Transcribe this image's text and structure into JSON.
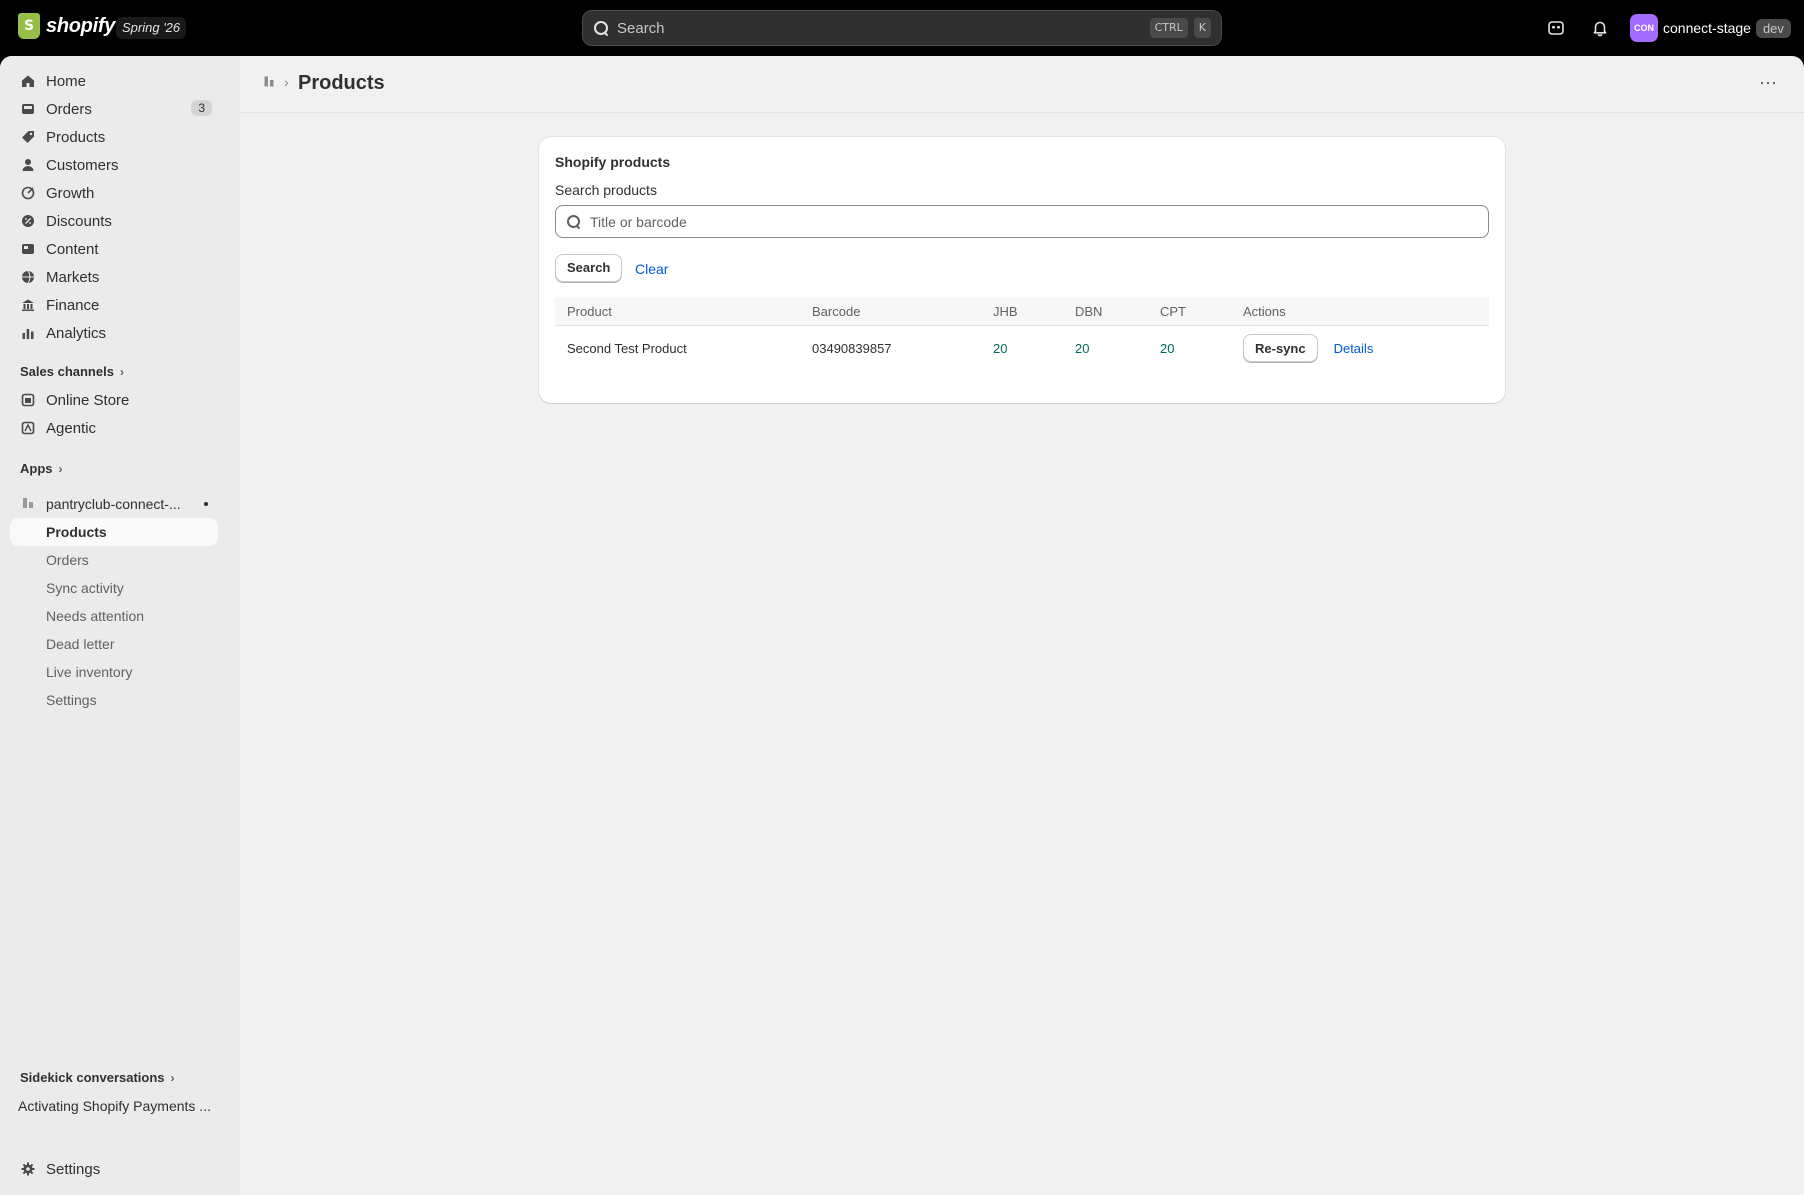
{
  "topbar": {
    "brand": "shopify",
    "version": "Spring '26",
    "search_placeholder": "Search",
    "shortcut_keys": [
      "CTRL",
      "K"
    ],
    "store_avatar": "CON",
    "store_name": "connect-stage",
    "env": "dev"
  },
  "sidebar": {
    "main_items": [
      {
        "label": "Home",
        "icon": "home-icon"
      },
      {
        "label": "Orders",
        "icon": "inbox-icon",
        "badge": "3"
      },
      {
        "label": "Products",
        "icon": "tag-icon"
      },
      {
        "label": "Customers",
        "icon": "person-icon"
      },
      {
        "label": "Growth",
        "icon": "target-icon"
      },
      {
        "label": "Discounts",
        "icon": "discount-icon"
      },
      {
        "label": "Content",
        "icon": "content-icon"
      },
      {
        "label": "Markets",
        "icon": "globe-icon"
      },
      {
        "label": "Finance",
        "icon": "bank-icon"
      },
      {
        "label": "Analytics",
        "icon": "chart-icon"
      }
    ],
    "sales_channels_title": "Sales channels",
    "sales_channels": [
      {
        "label": "Online Store",
        "icon": "store-icon"
      },
      {
        "label": "Agentic",
        "icon": "agentic-icon"
      }
    ],
    "apps_title": "Apps",
    "app_name": "pantryclub-connect-...",
    "app_subitems": [
      "Products",
      "Orders",
      "Sync activity",
      "Needs attention",
      "Dead letter",
      "Live inventory",
      "Settings"
    ],
    "sidekick_title": "Sidekick conversations",
    "sidekick_item": "Activating Shopify Payments ...",
    "settings": "Settings"
  },
  "page": {
    "title": "Products",
    "card": {
      "title": "Shopify products",
      "search_label": "Search products",
      "search_placeholder": "Title or barcode",
      "search_button": "Search",
      "clear_link": "Clear",
      "columns": [
        "Product",
        "Barcode",
        "JHB",
        "DBN",
        "CPT",
        "Actions"
      ],
      "rows": [
        {
          "product": "Second Test Product",
          "barcode": "03490839857",
          "jhb": "20",
          "dbn": "20",
          "cpt": "20",
          "resync": "Re-sync",
          "details": "Details"
        }
      ]
    }
  }
}
